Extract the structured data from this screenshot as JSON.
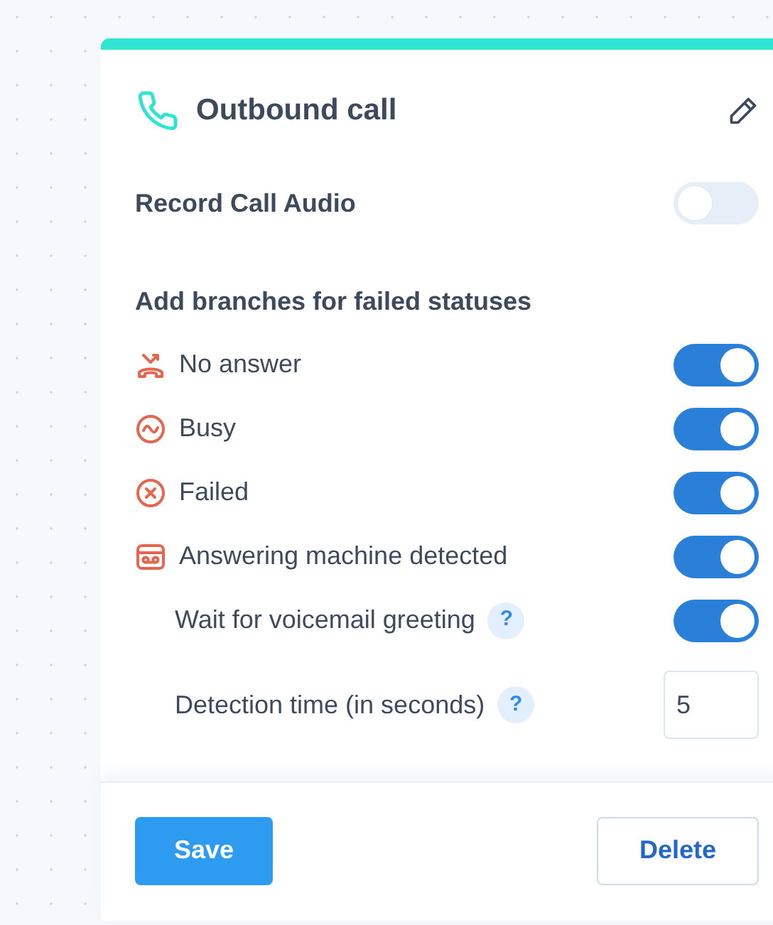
{
  "panel": {
    "title": "Outbound call"
  },
  "record_audio": {
    "label": "Record Call Audio",
    "on": false
  },
  "branches": {
    "heading": "Add branches for failed statuses",
    "rows": [
      {
        "kind": "no_answer",
        "label": "No answer",
        "on": true
      },
      {
        "kind": "busy",
        "label": "Busy",
        "on": true
      },
      {
        "kind": "failed",
        "label": "Failed",
        "on": true
      },
      {
        "kind": "machine",
        "label": "Answering machine detected",
        "on": true
      },
      {
        "kind": "sub_toggle",
        "label": "Wait for voicemail greeting",
        "help": "?",
        "on": true
      },
      {
        "kind": "sub_number",
        "label": "Detection time (in seconds)",
        "help": "?",
        "value": "5"
      }
    ]
  },
  "footer": {
    "save": "Save",
    "delete": "Delete"
  }
}
